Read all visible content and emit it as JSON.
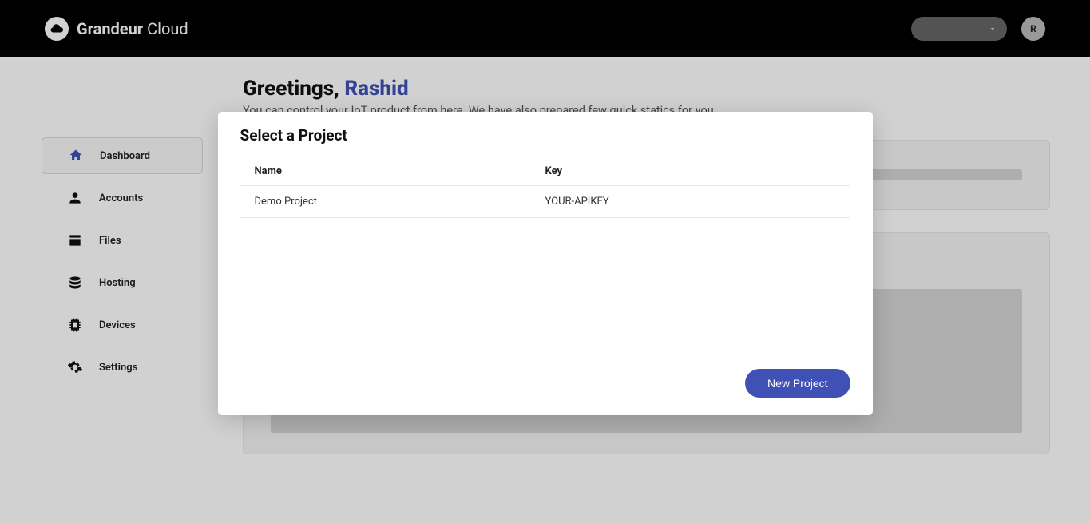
{
  "header": {
    "brand_bold": "Grandeur",
    "brand_light": "Cloud",
    "avatar_initial": "R"
  },
  "sidebar": {
    "items": [
      {
        "label": "Dashboard"
      },
      {
        "label": "Accounts"
      },
      {
        "label": "Files"
      },
      {
        "label": "Hosting"
      },
      {
        "label": "Devices"
      },
      {
        "label": "Settings"
      }
    ]
  },
  "content": {
    "greeting_prefix": "Greetings, ",
    "greeting_name": "Rashid",
    "subgreeting": "You can control your IoT product from here. We have also prepared few quick statics for you."
  },
  "modal": {
    "title": "Select a Project",
    "columns": {
      "name": "Name",
      "key": "Key"
    },
    "rows": [
      {
        "name": "Demo Project",
        "key": "YOUR-APIKEY"
      }
    ],
    "new_project_label": "New Project"
  },
  "colors": {
    "accent": "#3f51b5"
  }
}
